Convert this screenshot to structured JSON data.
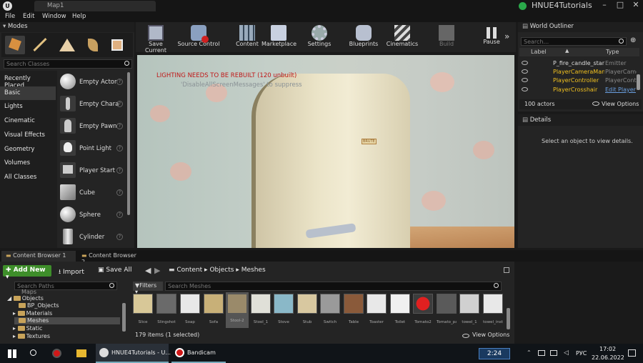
{
  "window": {
    "tab": "Map1",
    "project": "HNUE4Tutorials"
  },
  "menu": [
    "File",
    "Edit",
    "Window",
    "Help"
  ],
  "modes": {
    "title": "Modes",
    "search_placeholder": "Search Classes",
    "categories": [
      "Recently Placed",
      "Basic",
      "Lights",
      "Cinematic",
      "Visual Effects",
      "Geometry",
      "Volumes",
      "All Classes"
    ],
    "selected_category": "Basic",
    "items": [
      "Empty Actor",
      "Empty Chara",
      "Empty Pawn",
      "Point Light",
      "Player Start",
      "Cube",
      "Sphere",
      "Cylinder"
    ]
  },
  "toolbar": [
    {
      "label": "Save Current",
      "icon": "save-icon"
    },
    {
      "label": "Source Control",
      "icon": "source-control-icon"
    },
    {
      "label": "Content",
      "icon": "content-icon"
    },
    {
      "label": "Marketplace",
      "icon": "marketplace-icon"
    },
    {
      "label": "Settings",
      "icon": "settings-icon"
    },
    {
      "label": "Blueprints",
      "icon": "blueprints-icon"
    },
    {
      "label": "Cinematics",
      "icon": "cinematics-icon"
    },
    {
      "label": "Build",
      "icon": "build-icon"
    },
    {
      "label": "Pause",
      "icon": "pause-icon"
    }
  ],
  "viewport": {
    "warning": "LIGHTING NEEDS TO BE REBUILT (120 unbuilt)",
    "hint": "'DisableAllScreenMessages' to suppress",
    "label_text": "BRUTE"
  },
  "outliner": {
    "title": "World Outliner",
    "search_placeholder": "Search...",
    "col_label": "Label",
    "col_type": "Type",
    "rows": [
      {
        "name": "P_fire_candle_stand",
        "type": "Emitter"
      },
      {
        "name": "PlayerCameraMana",
        "type": "PlayerCame"
      },
      {
        "name": "PlayerController",
        "type": "PlayerContr"
      },
      {
        "name": "PlayerCrosshair",
        "type": "Edit Player"
      }
    ],
    "count": "100 actors",
    "view_options": "View Options"
  },
  "details": {
    "title": "Details",
    "empty": "Select an object to view details."
  },
  "content_browser": {
    "tabs": [
      "Content Browser 1",
      "Content Browser 2"
    ],
    "add_new": "Add New",
    "import": "Import",
    "save_all": "Save All",
    "path": [
      "Content",
      "Objects",
      "Meshes"
    ],
    "search_paths": "Search Paths",
    "filters": "Filters",
    "search_meshes": "Search Meshes",
    "tree": [
      {
        "label": "Maps",
        "indent": 1
      },
      {
        "label": "Objects",
        "indent": 1
      },
      {
        "label": "BP_Objects",
        "indent": 2
      },
      {
        "label": "Materials",
        "indent": 2
      },
      {
        "label": "Meshes",
        "indent": 2
      },
      {
        "label": "Static",
        "indent": 1
      },
      {
        "label": "Textures",
        "indent": 1
      }
    ],
    "assets": [
      "Slice",
      "Slingshot",
      "Soap",
      "Sofa",
      "Stool-2",
      "Stool_1",
      "Stove",
      "Stub",
      "Switch",
      "Table",
      "Toaster",
      "Toilet",
      "Tomato2",
      "Tomato_part",
      "towel_1",
      "towel_inst"
    ],
    "status": "179 items (1 selected)",
    "view_options": "View Options"
  },
  "taskbar": {
    "apps": [
      "HNUE4Tutorials - U...",
      "Bandicam"
    ],
    "timer": "2:24",
    "lang": "РУС",
    "time": "17:02",
    "date": "22.06.2022"
  }
}
